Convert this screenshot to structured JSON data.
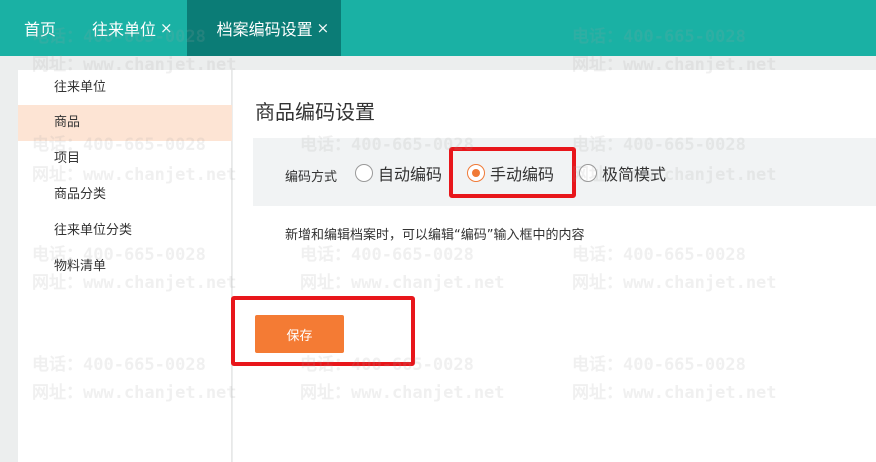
{
  "tabs": [
    {
      "label": "首页",
      "closable": false,
      "active": false
    },
    {
      "label": "往来单位",
      "closable": true,
      "active": false
    },
    {
      "label": "档案编码设置",
      "closable": true,
      "active": true
    }
  ],
  "close_glyph": "×",
  "sidebar": {
    "items": [
      {
        "label": "往来单位",
        "active": false
      },
      {
        "label": "商品",
        "active": true
      },
      {
        "label": "项目",
        "active": false
      },
      {
        "label": "商品分类",
        "active": false
      },
      {
        "label": "往来单位分类",
        "active": false
      },
      {
        "label": "物料清单",
        "active": false
      }
    ]
  },
  "main": {
    "title": "商品编码设置",
    "encoding_label": "编码方式",
    "options": [
      {
        "label": "自动编码",
        "checked": false
      },
      {
        "label": "手动编码",
        "checked": true
      },
      {
        "label": "极简模式",
        "checked": false
      }
    ],
    "hint": "新增和编辑档案时，可以编辑“编码”输入框中的内容",
    "save_label": "保存"
  },
  "watermark": {
    "line1": "电话：400-665-0028",
    "line2": "网址：www.chanjet.net"
  },
  "colors": {
    "header": "#1ab1a4",
    "active_tab": "#0b7c76",
    "accent": "#f47b34",
    "selected_item": "#fde4d4",
    "annotation": "#e8161b"
  }
}
